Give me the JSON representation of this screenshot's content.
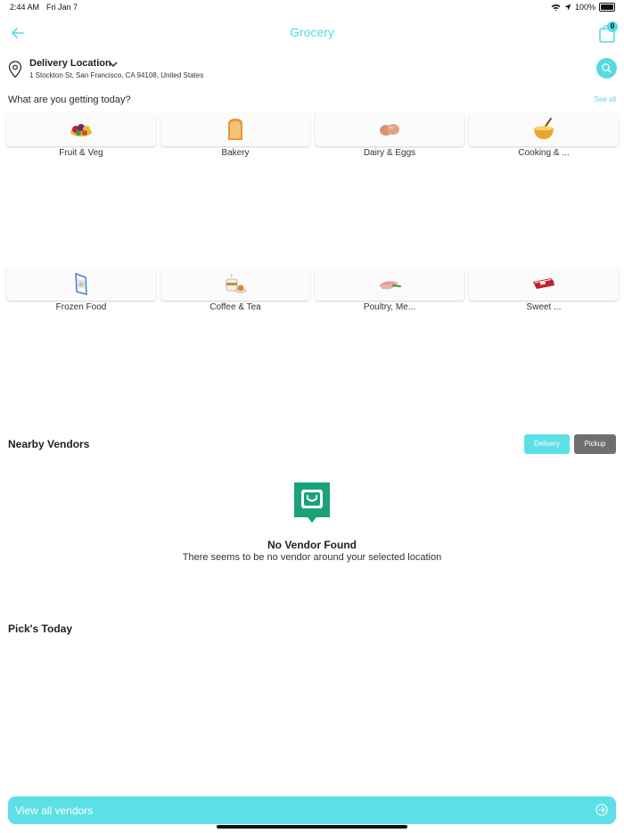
{
  "status": {
    "time": "2:44 AM",
    "date": "Fri Jan 7",
    "battery": "100%"
  },
  "header": {
    "title": "Grocery",
    "cart_count": "0"
  },
  "location": {
    "title": "Delivery Location",
    "address": "1 Stockton St, San Francisco, CA  94108, United States"
  },
  "categories": {
    "heading": "What are you getting today?",
    "see_all": "See all",
    "items": [
      {
        "label": "Fruit & Veg",
        "icon": "fruit-veg-icon"
      },
      {
        "label": "Bakery",
        "icon": "bread-icon"
      },
      {
        "label": "Dairy & Eggs",
        "icon": "eggs-icon"
      },
      {
        "label": "Cooking & ...",
        "icon": "mixing-bowl-icon"
      },
      {
        "label": "Frozen Food",
        "icon": "frozen-pack-icon"
      },
      {
        "label": "Coffee & Tea",
        "icon": "coffee-cup-icon"
      },
      {
        "label": "Poultry, Me...",
        "icon": "meat-icon"
      },
      {
        "label": "Sweet ...",
        "icon": "candy-bar-icon"
      }
    ]
  },
  "nearby": {
    "title": "Nearby Vendors",
    "delivery_label": "Delivery",
    "pickup_label": "Pickup",
    "empty_title": "No Vendor Found",
    "empty_message": "There seems to be no vendor around your selected location"
  },
  "picks": {
    "title": "Pick's Today"
  },
  "footer": {
    "view_all": "View all vendors"
  },
  "colors": {
    "accent": "#55dbe0",
    "pickup": "#6f6f6f",
    "empty_icon": "#1aa37a"
  }
}
